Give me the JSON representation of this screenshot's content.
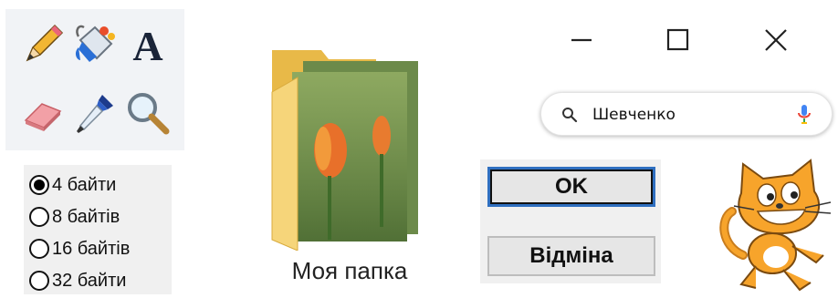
{
  "tools": [
    {
      "name": "pencil-icon"
    },
    {
      "name": "fill-bucket-icon"
    },
    {
      "name": "text-icon",
      "glyph": "A"
    },
    {
      "name": "eraser-icon"
    },
    {
      "name": "color-picker-icon"
    },
    {
      "name": "magnifier-icon"
    }
  ],
  "radios": [
    {
      "label": "4 байти",
      "checked": true
    },
    {
      "label": "8 байтів",
      "checked": false
    },
    {
      "label": "16 байтів",
      "checked": false
    },
    {
      "label": "32 байти",
      "checked": false
    }
  ],
  "folder": {
    "label": "Моя папка"
  },
  "window_controls": [
    "minimize-icon",
    "maximize-icon",
    "close-icon"
  ],
  "search": {
    "value": "Шевченко"
  },
  "dialog": {
    "ok_label": "OK",
    "cancel_label": "Відміна"
  },
  "colors": {
    "ok_border": "#2f6fc0",
    "mic_blue": "#4285f4",
    "mic_red": "#ea4335",
    "folder_yellow": "#f3cf6e",
    "scratch_orange": "#f7a42b"
  }
}
